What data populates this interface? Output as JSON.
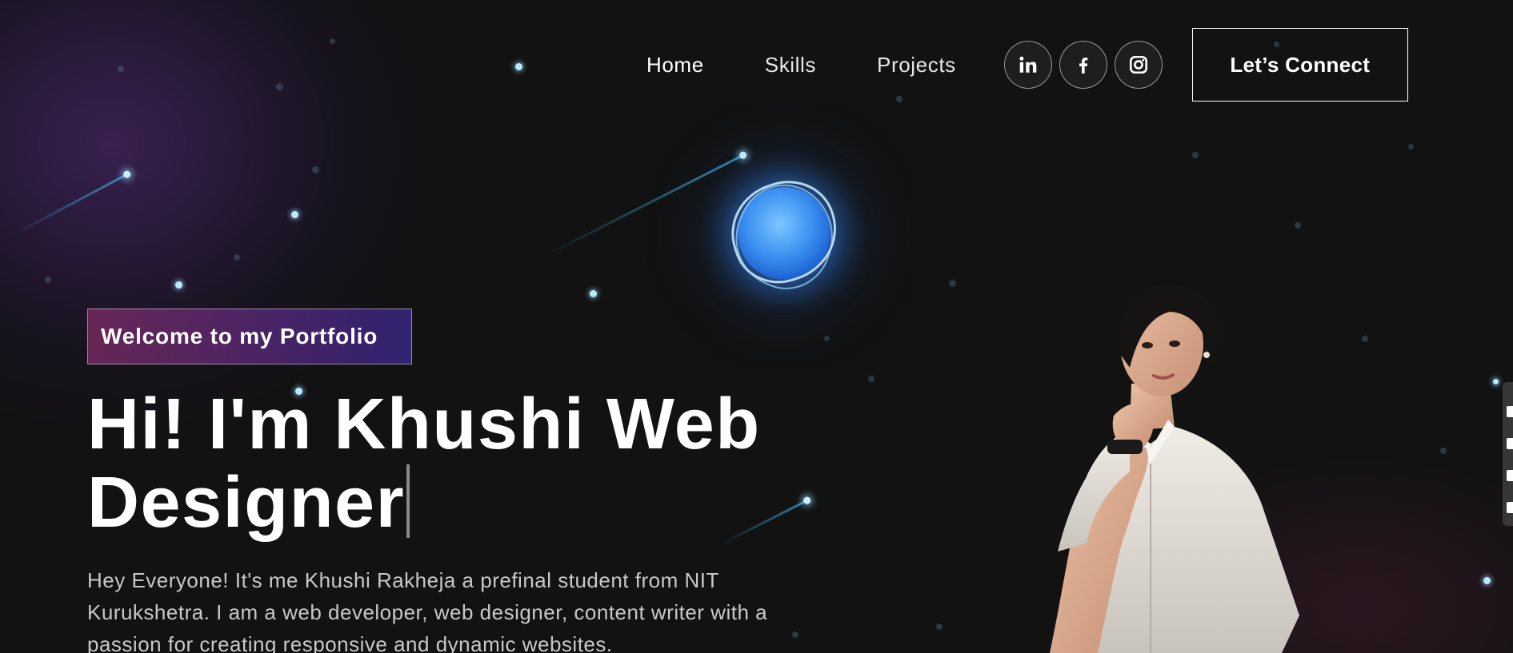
{
  "nav": {
    "links": [
      {
        "label": "Home"
      },
      {
        "label": "Skills"
      },
      {
        "label": "Projects"
      }
    ],
    "socials": [
      {
        "icon": "linkedin-icon"
      },
      {
        "icon": "facebook-icon"
      },
      {
        "icon": "instagram-icon"
      }
    ],
    "cta_label": "Let’s Connect"
  },
  "hero": {
    "tagline": "Welcome to my Portfolio",
    "title_line1": "Hi! I'm Khushi Web",
    "title_line2": "Designer",
    "description": "Hey Everyone! It's me Khushi Rakheja a prefinal student from NIT Kurukshetra. I am a web developer, web designer, content writer with a passion for creating responsive and dynamic websites."
  },
  "colors": {
    "background": "#121212",
    "tagline_gradient_start": "#aa367c",
    "tagline_gradient_end": "#4a2fbd",
    "orb": "#3a8ff0",
    "star": "#b9eaff"
  }
}
